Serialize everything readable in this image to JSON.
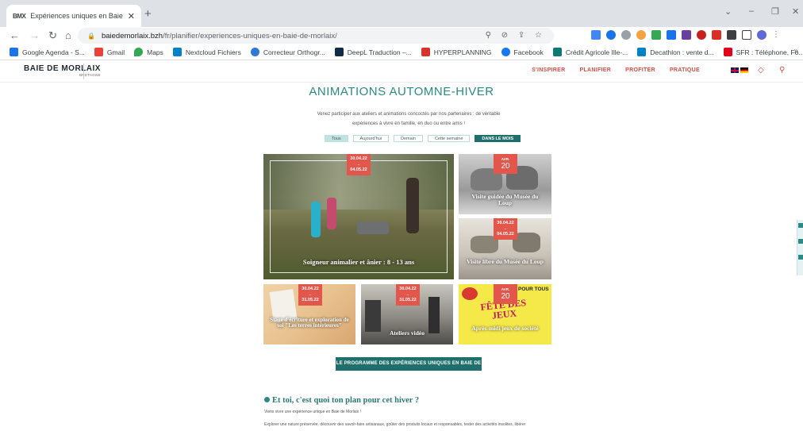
{
  "browser": {
    "tab_title": "Expériences uniques en Baie de M",
    "tab_favicon": "BMX",
    "url_host": "baiedemorlaix.bzh",
    "url_path": "/fr/planifier/experiences-uniques-en-baie-de-morlaix/",
    "bookmarks": [
      {
        "label": "Google Agenda - S...",
        "icon": "calendar-icon",
        "color": "#1a73e8"
      },
      {
        "label": "Gmail",
        "icon": "gmail-icon",
        "color": "#ea4335"
      },
      {
        "label": "Maps",
        "icon": "maps-icon",
        "color": "#34a853"
      },
      {
        "label": "Nextcloud Fichiers",
        "icon": "nextcloud-icon",
        "color": "#0082c9"
      },
      {
        "label": "Correcteur Orthogr...",
        "icon": "correcteur-icon",
        "color": "#2d7ad6"
      },
      {
        "label": "DeepL Traduction –...",
        "icon": "deepl-icon",
        "color": "#0f2b46"
      },
      {
        "label": "HYPERPLANNING",
        "icon": "hyperplanning-icon",
        "color": "#d9322c"
      },
      {
        "label": "Facebook",
        "icon": "facebook-icon",
        "color": "#1877f2"
      },
      {
        "label": "Crédit Agricole Ille-...",
        "icon": "credit-agricole-icon",
        "color": "#0b7a75"
      },
      {
        "label": "Decathlon : vente d...",
        "icon": "decathlon-icon",
        "color": "#0082c3"
      },
      {
        "label": "SFR : Téléphone, Fo...",
        "icon": "sfr-icon",
        "color": "#e2001a"
      }
    ]
  },
  "site": {
    "logo_line1": "BAIE DE MORLAIX",
    "logo_line2": "BRETAGNE",
    "menu": [
      "S'INSPIRER",
      "PLANIFIER",
      "PROFITER",
      "PRATIQUE"
    ],
    "accent": "#d94c41",
    "teal": "#2a8a86"
  },
  "page": {
    "title": "ANIMATIONS AUTOMNE-HIVER",
    "intro_line1": "Venez participer aux ateliers et animations concoctés par nos partenaires : de véritable",
    "intro_line2": "expériences à vivre en famille, en duo ou entre amis !",
    "filters": [
      "Tous",
      "Aujourd'hui",
      "Demain",
      "Cette semaine",
      "DANS LE MOIS"
    ],
    "cards": {
      "c1": {
        "title": "Soigneur animalier et ânier : 8 - 13 ans",
        "date_from": "30.04.22",
        "date_to": "04.05.22"
      },
      "c2": {
        "title": "Visite guidée du Musée du Loup",
        "prefix": "AVR.",
        "day": "20"
      },
      "c3": {
        "title": "Visite libre du Musée du Loup",
        "date_from": "30.04.22",
        "date_to": "04.05.22"
      },
      "c4": {
        "title": "Stage d'écriture et exploration de soi \"Les terres intérieures\"",
        "date_from": "30.04.22",
        "date_to": "31.05.22"
      },
      "c5": {
        "title": "Ateliers vidéo",
        "date_from": "30.04.22",
        "date_to": "31.05.22"
      },
      "c6": {
        "title": "Après-midi jeux de société",
        "prefix": "AVR.",
        "day": "20",
        "tag": "POUR TOUS",
        "poster_text": "FÊTE DES JEUX"
      }
    },
    "cta": "LE PROGRAMME DES EXPÉRIENCES UNIQUES EN BAIE DE MORLAIX",
    "subtitle": "Et toi, c'est quoi ton plan pour cet hiver ?",
    "p1": "Viens vivre une expérience unique en Baie de Morlaix !",
    "p2": "Explorer une nature préservée, découvrir des savoir-faire artisanaux, goûter des produits locaux et responsables, tester des activités insolites, libérer"
  }
}
